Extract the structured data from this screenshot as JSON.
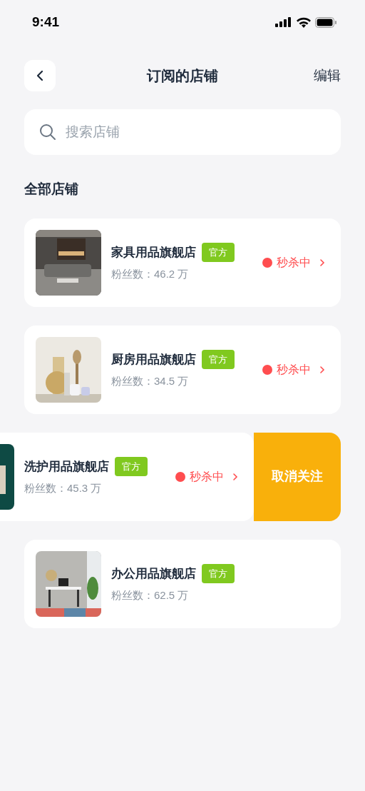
{
  "status_bar": {
    "time": "9:41"
  },
  "nav": {
    "title": "订阅的店铺",
    "action": "编辑"
  },
  "search": {
    "placeholder": "搜索店铺"
  },
  "section_title": "全部店铺",
  "stores": [
    {
      "name": "家具用品旗舰店",
      "badge": "官方",
      "fans": "粉丝数：46.2 万",
      "flash_sale": "秒杀中",
      "swiped": false
    },
    {
      "name": "厨房用品旗舰店",
      "badge": "官方",
      "fans": "粉丝数：34.5 万",
      "flash_sale": "秒杀中",
      "swiped": false
    },
    {
      "name": "洗护用品旗舰店",
      "badge": "官方",
      "fans": "粉丝数：45.3 万",
      "flash_sale": "秒杀中",
      "swiped": true,
      "swipe_action": "取消关注"
    },
    {
      "name": "办公用品旗舰店",
      "badge": "官方",
      "fans": "粉丝数：62.5 万",
      "swiped": false
    }
  ]
}
